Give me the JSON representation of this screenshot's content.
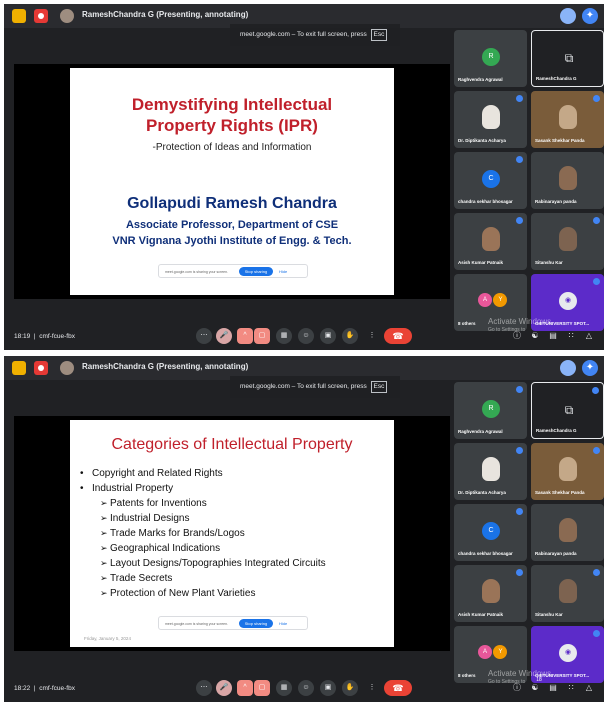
{
  "top_bar": {
    "presenter_label": "RameshChandra G (Presenting, annotating)"
  },
  "fullscreen_toast": {
    "text": "meet.google.com – To exit full screen, press",
    "key": "Esc"
  },
  "slide1": {
    "title_line1": "Demystifying Intellectual",
    "title_line2": "Property Rights (IPR)",
    "subtitle": "-Protection of Ideas and Information",
    "name": "Gollapudi Ramesh Chandra",
    "line2": "Associate Professor, Department of CSE",
    "line3": "VNR Vignana Jyothi Institute of Engg. & Tech."
  },
  "slide2": {
    "title": "Categories of Intellectual Property",
    "bullets": [
      "Copyright and Related Rights",
      "Industrial Property"
    ],
    "subitems": [
      "Patents for Inventions",
      "Industrial Designs",
      "Trade Marks for Brands/Logos",
      "Geographical Indications",
      "Layout Designs/Topographies Integrated Circuits",
      "Trade Secrets",
      "Protection of New Plant Varieties"
    ],
    "date": "Friday, January 5, 2024"
  },
  "share_bar": {
    "text": "meet.google.com is sharing your screen.",
    "stop": "Stop sharing",
    "hide": "Hide"
  },
  "participants": [
    {
      "name": "Raghvendra Agrawal",
      "initial": "R",
      "color": "#34a853"
    },
    {
      "name": "RameshChandra G",
      "initial": "",
      "color": "#202124"
    },
    {
      "name": "Dr. Diptikanta Acharya",
      "initial": "",
      "color": "#3c4043"
    },
    {
      "name": "Sasank Shekhar Panda",
      "initial": "",
      "color": "#7a5c3a"
    },
    {
      "name": "chandra sekhar bhosagar",
      "initial": "C",
      "color": "#1a73e8"
    },
    {
      "name": "Rabinarayan panda",
      "initial": "",
      "color": "#3c4043"
    },
    {
      "name": "Asish Kumar Patnaik",
      "initial": "",
      "color": "#3c4043"
    },
    {
      "name": "Sitanshu Kar",
      "initial": "",
      "color": "#3c4043"
    },
    {
      "name": "8 others",
      "initial": "",
      "color": "#3c4043"
    },
    {
      "name": "GIETUNIVERSITY SPOT...",
      "initial": "",
      "color": "#5c2bc9"
    }
  ],
  "others_avatars": [
    "A",
    "Y"
  ],
  "watermark": {
    "line1": "Activate Windows",
    "line2": "Go to Settings to"
  },
  "controls": {
    "meeting_code": "cmf-fcue-fbx",
    "time1": "18:19",
    "time2": "18:22",
    "people_count": "18"
  },
  "colors": {
    "accent": "#1a73e8",
    "end_call": "#ea4335",
    "title_red": "#c0202b",
    "title_blue": "#0f2f79"
  }
}
